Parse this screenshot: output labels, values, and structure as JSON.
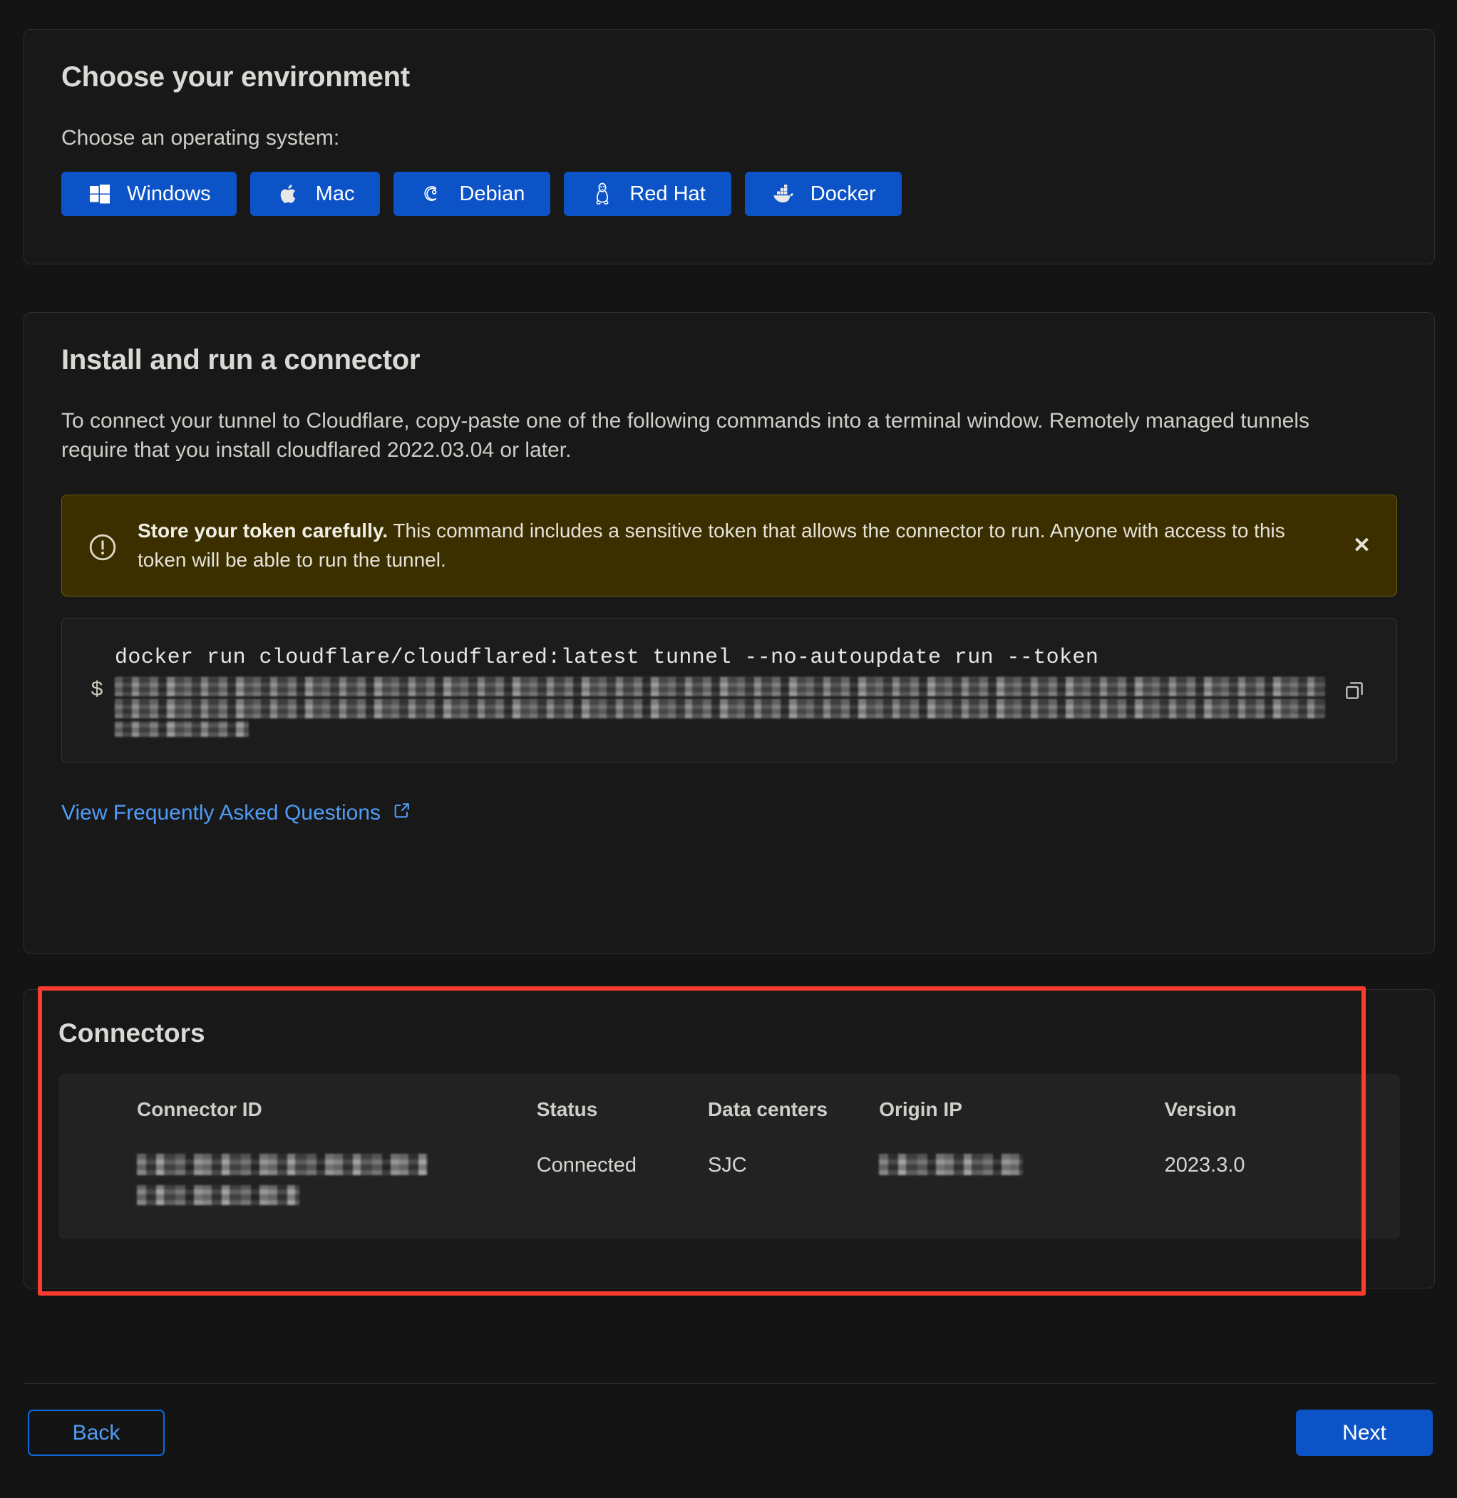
{
  "environment": {
    "title": "Choose your environment",
    "os_label": "Choose an operating system:",
    "os_options": [
      {
        "label": "Windows",
        "icon": "windows-icon"
      },
      {
        "label": "Mac",
        "icon": "apple-icon"
      },
      {
        "label": "Debian",
        "icon": "debian-icon"
      },
      {
        "label": "Red Hat",
        "icon": "linux-penguin-icon"
      },
      {
        "label": "Docker",
        "icon": "docker-icon"
      }
    ]
  },
  "install": {
    "title": "Install and run a connector",
    "description": "To connect your tunnel to Cloudflare, copy-paste one of the following commands into a terminal window. Remotely managed tunnels require that you install cloudflared 2022.03.04 or later.",
    "warning": {
      "bold": "Store your token carefully.",
      "text": "This command includes a sensitive token that allows the connector to run. Anyone with access to this token will be able to run the tunnel.",
      "icon": "alert-circle-icon",
      "close_label": "✕"
    },
    "command": {
      "prompt": "$",
      "text": "docker run cloudflare/cloudflared:latest tunnel --no-autoupdate run --token",
      "token_redacted": true,
      "copy_icon": "copy-icon"
    },
    "faq_link": {
      "label": "View Frequently Asked Questions",
      "icon": "external-link-icon"
    }
  },
  "connectors": {
    "title": "Connectors",
    "columns": [
      "Connector ID",
      "Status",
      "Data centers",
      "Origin IP",
      "Version"
    ],
    "rows": [
      {
        "connector_id": "",
        "connector_id_redacted": true,
        "status": "Connected",
        "data_centers": "SJC",
        "origin_ip": "",
        "origin_ip_redacted": true,
        "version": "2023.3.0"
      }
    ]
  },
  "footer": {
    "back_label": "Back",
    "next_label": "Next"
  },
  "annotation": {
    "color": "#ff3b30",
    "target": "connectors-card"
  },
  "colors": {
    "page_background": "#141414",
    "card_background": "#181818",
    "panel_background": "#222222",
    "accent_blue": "#0c53c7",
    "link_blue": "#4f9cf5",
    "warning_background": "#3b2f00",
    "highlight_red": "#ff3b30"
  }
}
